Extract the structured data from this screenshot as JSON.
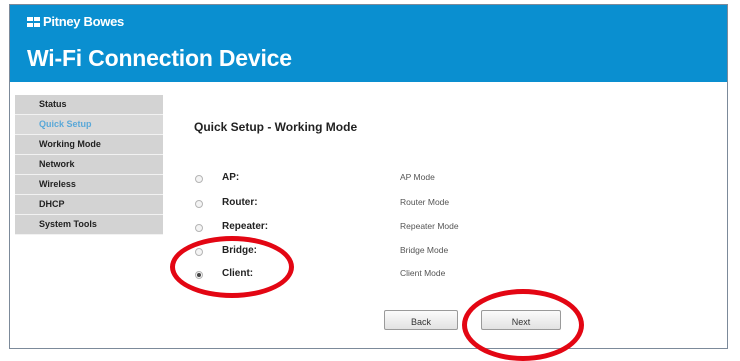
{
  "header": {
    "brand": "Pitney Bowes",
    "title": "Wi-Fi Connection Device",
    "color": "#0a8fd0"
  },
  "sidebar": {
    "items": [
      {
        "label": "Status",
        "active": false
      },
      {
        "label": "Quick Setup",
        "active": true
      },
      {
        "label": "Working Mode",
        "active": false
      },
      {
        "label": "Network",
        "active": false
      },
      {
        "label": "Wireless",
        "active": false
      },
      {
        "label": "DHCP",
        "active": false
      },
      {
        "label": "System Tools",
        "active": false
      }
    ]
  },
  "main": {
    "section_title": "Quick Setup - Working Mode",
    "modes": [
      {
        "label": "AP:",
        "description": "AP Mode",
        "selected": false
      },
      {
        "label": "Router:",
        "description": "Router Mode",
        "selected": false
      },
      {
        "label": "Repeater:",
        "description": "Repeater Mode",
        "selected": false
      },
      {
        "label": "Bridge:",
        "description": "Bridge Mode",
        "selected": false
      },
      {
        "label": "Client:",
        "description": "Client Mode",
        "selected": true
      }
    ],
    "back_label": "Back",
    "next_label": "Next"
  },
  "annotation_color": "#e30613"
}
